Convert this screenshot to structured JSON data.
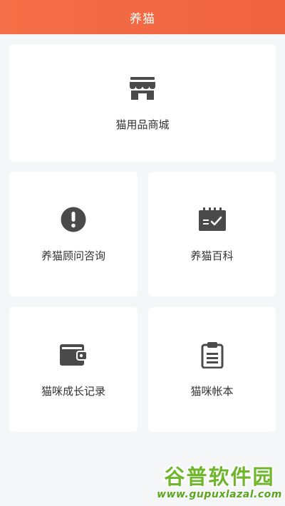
{
  "header": {
    "title": "养猫"
  },
  "cards": {
    "shop": {
      "label": "猫用品商城",
      "icon": "store-icon"
    },
    "consult": {
      "label": "养猫顾问咨询",
      "icon": "exclamation-circle-icon"
    },
    "wiki": {
      "label": "养猫百科",
      "icon": "calendar-check-icon"
    },
    "growth": {
      "label": "猫咪成长记录",
      "icon": "wallet-icon"
    },
    "ledger": {
      "label": "猫咪帐本",
      "icon": "clipboard-icon"
    }
  },
  "watermark": {
    "main": "谷普软件园",
    "url": "www.gupuxlazal.com"
  },
  "colors": {
    "header": "#f46e47",
    "icon": "#4a4a4a",
    "watermark": "#6fb62c"
  }
}
